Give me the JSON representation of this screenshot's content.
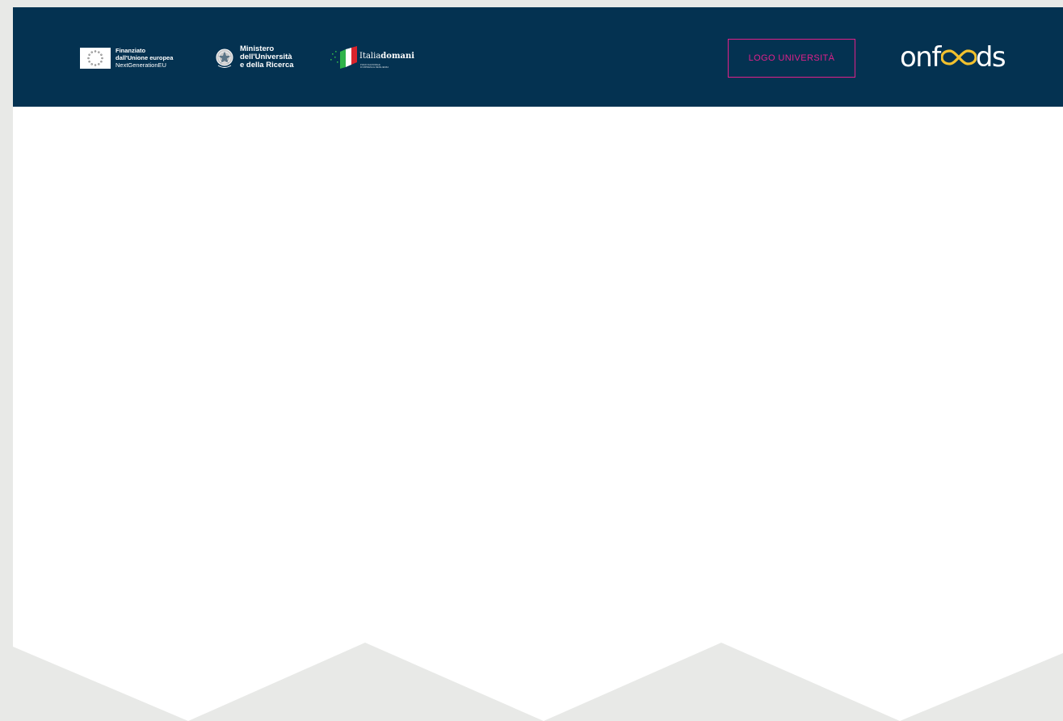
{
  "header": {
    "eu_logo": {
      "line1": "Finanziato",
      "line2": "dall'Unione europea",
      "line3": "NextGenerationEU"
    },
    "ministry_logo": {
      "line1": "Ministero",
      "line2": "dell'Università",
      "line3": "e della Ricerca"
    },
    "italia_domani_logo": {
      "part1": "Italia",
      "part2": "domani",
      "sub1": "PIANO NAZIONALE",
      "sub2": "DI RIPRESA E RESILIENZA"
    },
    "university_logo_placeholder": "LOGO UNIVERSITÀ",
    "brand_logo": {
      "prefix": "onf",
      "suffix": "ds"
    }
  },
  "colors": {
    "header_bg": "#043251",
    "page_bg": "#e8e9e7",
    "content_bg": "#ffffff",
    "accent_magenta": "#e0208a",
    "logo_yellow": "#f2c12e"
  }
}
